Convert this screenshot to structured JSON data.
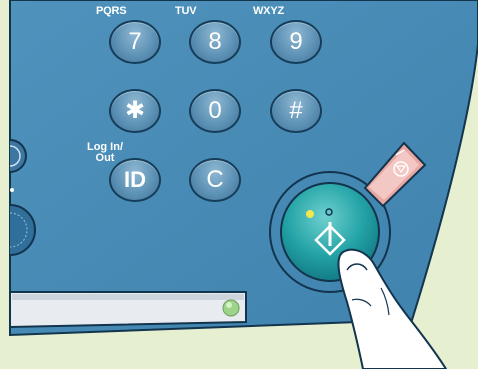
{
  "keypad": {
    "keys": [
      {
        "label": "7",
        "sub": "PQRS"
      },
      {
        "label": "8",
        "sub": "TUV"
      },
      {
        "label": "9",
        "sub": "WXYZ"
      },
      {
        "label": "✱"
      },
      {
        "label": "0"
      },
      {
        "label": "#"
      },
      {
        "label": "ID"
      },
      {
        "label": "C"
      }
    ],
    "login_label_line1": "Log In/",
    "login_label_line2": "Out"
  },
  "colors": {
    "panel": "#4a8fb8",
    "background": "#e6efcf",
    "start_button": "#2aa1a6",
    "stop_button": "#e8a7a2",
    "indicator_yellow": "#f1e84d",
    "indicator_green": "#9ed48a"
  },
  "icons": [
    "start-icon",
    "stop-icon",
    "pointing-hand"
  ]
}
